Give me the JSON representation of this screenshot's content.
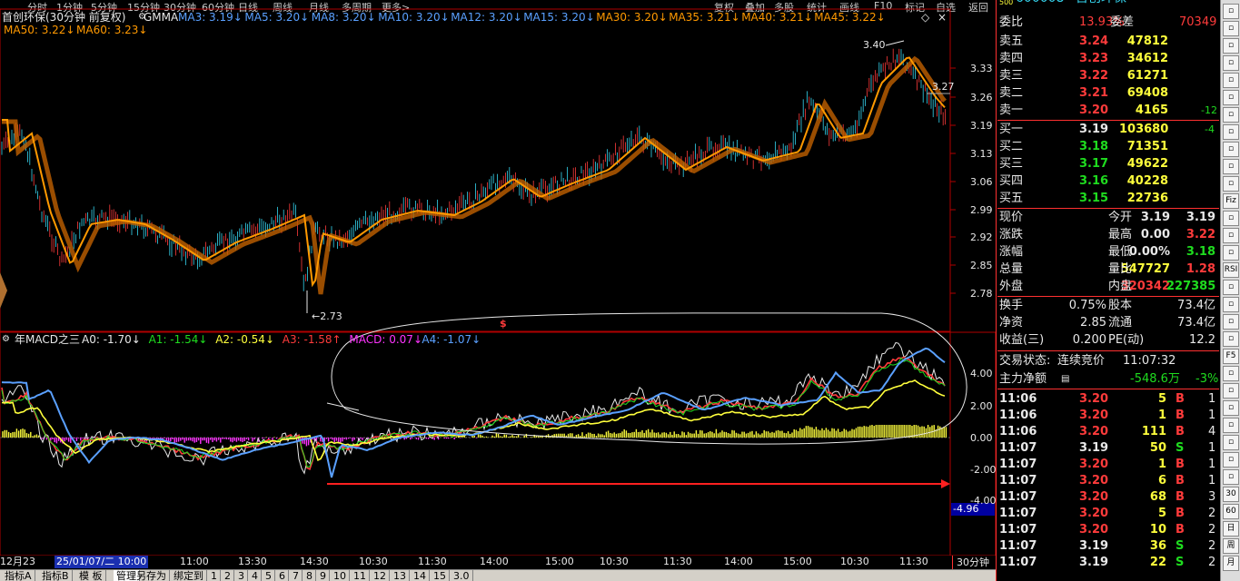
{
  "top_menu": [
    "分时",
    "1分钟",
    "5分钟",
    "15分钟",
    "30分钟",
    "60分钟",
    "日线",
    "周线",
    "月线",
    "多周期",
    "更多>",
    "复权",
    "叠加",
    "多股",
    "统计",
    "画线",
    "F10",
    "标记",
    "自选",
    "返回"
  ],
  "stock_code": "600008",
  "stock_name": "首创环保",
  "stock_code_small": "500",
  "main_header": {
    "title": "首创环保(30分钟 前复权)",
    "indicator": "GMMA",
    "mas": [
      {
        "label": "MA3: 3.19",
        "arrow": "↓",
        "color": "#5aa0ff"
      },
      {
        "label": "MA5: 3.20",
        "arrow": "↓",
        "color": "#5aa0ff"
      },
      {
        "label": "MA8: 3.20",
        "arrow": "↓",
        "color": "#5aa0ff"
      },
      {
        "label": "MA10: 3.20",
        "arrow": "↓",
        "color": "#5aa0ff"
      },
      {
        "label": "MA12: 3.20",
        "arrow": "↓",
        "color": "#5aa0ff"
      },
      {
        "label": "MA15: 3.20",
        "arrow": "↓",
        "color": "#5aa0ff"
      },
      {
        "label": "MA30: 3.20",
        "arrow": "↓",
        "color": "#ff9900"
      },
      {
        "label": "MA35: 3.21",
        "arrow": "↓",
        "color": "#ff9900"
      },
      {
        "label": "MA40: 3.21",
        "arrow": "↓",
        "color": "#ff9900"
      },
      {
        "label": "MA45: 3.22",
        "arrow": "↓",
        "color": "#ff9900"
      },
      {
        "label": "MA50: 3.22",
        "arrow": "↓",
        "color": "#ff9900"
      },
      {
        "label": "MA60: 3.23",
        "arrow": "↓",
        "color": "#ff9900"
      }
    ],
    "high_mark": "3.40",
    "low_mark": "2.73",
    "price_tag": "3.27"
  },
  "price_axis": [
    "3.33",
    "3.26",
    "3.19",
    "3.13",
    "3.06",
    "2.99",
    "2.92",
    "2.85",
    "2.78"
  ],
  "macd_header": {
    "title": "年MACD之三",
    "items": [
      {
        "label": "A0: -1.70",
        "arrow": "↓",
        "color": "#e8e8e8"
      },
      {
        "label": "A1: -1.54",
        "arrow": "↓",
        "color": "#1fdc1f"
      },
      {
        "label": "A2: -0.54",
        "arrow": "↓",
        "color": "#ffff3c"
      },
      {
        "label": "A3: -1.58",
        "arrow": "↑",
        "color": "#ff3b3b"
      },
      {
        "label": "MACD: 0.07",
        "arrow": "↓",
        "color": "#ff33ff"
      },
      {
        "label": "A4: -1.07",
        "arrow": "↓",
        "color": "#5aa0ff"
      }
    ],
    "marker": "$",
    "value_tag": "-4.96"
  },
  "macd_axis": [
    "4.00",
    "2.00",
    "0.00",
    "-2.00",
    "-4.00"
  ],
  "time_axis": [
    "12月23",
    "25/01/07/二 10:00",
    "11:00",
    "13:30",
    "14:30",
    "10:30",
    "11:30",
    "14:00",
    "15:00",
    "10:30",
    "11:30",
    "14:00",
    "15:00",
    "10:30",
    "11:30"
  ],
  "period_label": "30分钟",
  "bottom_tabs": [
    "指标A",
    "指标B",
    "模 板",
    "管理",
    "另存为",
    "绑定到",
    "1",
    "2",
    "3",
    "4",
    "5",
    "6",
    "7",
    "8",
    "9",
    "10",
    "11",
    "12",
    "13",
    "14",
    "15",
    "3.0"
  ],
  "order_book": {
    "weibi_label": "委比",
    "weibi_value": "13.93%",
    "weicha_label": "委差",
    "weicha_value": "70349",
    "sells": [
      {
        "label": "卖五",
        "price": "3.24",
        "vol": "47812",
        "chg": ""
      },
      {
        "label": "卖四",
        "price": "3.23",
        "vol": "34612",
        "chg": ""
      },
      {
        "label": "卖三",
        "price": "3.22",
        "vol": "61271",
        "chg": ""
      },
      {
        "label": "卖二",
        "price": "3.21",
        "vol": "69408",
        "chg": ""
      },
      {
        "label": "卖一",
        "price": "3.20",
        "vol": "4165",
        "chg": "-12"
      }
    ],
    "buys": [
      {
        "label": "买一",
        "price": "3.19",
        "vol": "103680",
        "chg": "-4"
      },
      {
        "label": "买二",
        "price": "3.18",
        "vol": "71351",
        "chg": ""
      },
      {
        "label": "买三",
        "price": "3.17",
        "vol": "49622",
        "chg": ""
      },
      {
        "label": "买四",
        "price": "3.16",
        "vol": "40228",
        "chg": ""
      },
      {
        "label": "买五",
        "price": "3.15",
        "vol": "22736",
        "chg": ""
      }
    ]
  },
  "quote": [
    {
      "l1": "现价",
      "v1": "3.19",
      "c1": "#e8e8e8",
      "l2": "今开",
      "v2": "3.19",
      "c2": "#e8e8e8"
    },
    {
      "l1": "涨跌",
      "v1": "0.00",
      "c1": "#e8e8e8",
      "l2": "最高",
      "v2": "3.22",
      "c2": "#ff3b3b"
    },
    {
      "l1": "涨幅",
      "v1": "0.00%",
      "c1": "#e8e8e8",
      "l2": "最低",
      "v2": "3.18",
      "c2": "#1fdc1f"
    },
    {
      "l1": "总量",
      "v1": "547727",
      "c1": "#ffff3c",
      "l2": "量比",
      "v2": "1.28",
      "c2": "#ff3b3b"
    },
    {
      "l1": "外盘",
      "v1": "320342",
      "c1": "#ff3b3b",
      "l2": "内盘",
      "v2": "227385",
      "c2": "#1fdc1f"
    }
  ],
  "quote2": [
    {
      "l1": "换手",
      "v1": "0.75%",
      "l2": "股本",
      "v2": "73.4亿"
    },
    {
      "l1": "净资",
      "v1": "2.85",
      "l2": "流通",
      "v2": "73.4亿"
    },
    {
      "l1": "收益(三)",
      "v1": "0.200",
      "l2": "PE(动)",
      "v2": "12.2"
    }
  ],
  "status": {
    "label": "交易状态:",
    "value": "连续竞价",
    "time": "11:07:32"
  },
  "netflow": {
    "label": "主力净额",
    "value": "-548.6万",
    "pct": "-3%"
  },
  "ticks": [
    {
      "time": "11:06",
      "price": "3.20",
      "vol": "5",
      "bs": "B",
      "n": "1",
      "pc": "#ff3b3b"
    },
    {
      "time": "11:06",
      "price": "3.20",
      "vol": "1",
      "bs": "B",
      "n": "1",
      "pc": "#ff3b3b"
    },
    {
      "time": "11:06",
      "price": "3.20",
      "vol": "111",
      "bs": "B",
      "n": "4",
      "pc": "#ff3b3b"
    },
    {
      "time": "11:07",
      "price": "3.19",
      "vol": "50",
      "bs": "S",
      "n": "1",
      "pc": "#e8e8e8"
    },
    {
      "time": "11:07",
      "price": "3.20",
      "vol": "1",
      "bs": "B",
      "n": "1",
      "pc": "#ff3b3b"
    },
    {
      "time": "11:07",
      "price": "3.20",
      "vol": "6",
      "bs": "B",
      "n": "1",
      "pc": "#ff3b3b"
    },
    {
      "time": "11:07",
      "price": "3.20",
      "vol": "68",
      "bs": "B",
      "n": "3",
      "pc": "#ff3b3b"
    },
    {
      "time": "11:07",
      "price": "3.20",
      "vol": "5",
      "bs": "B",
      "n": "2",
      "pc": "#ff3b3b"
    },
    {
      "time": "11:07",
      "price": "3.20",
      "vol": "10",
      "bs": "B",
      "n": "2",
      "pc": "#ff3b3b"
    },
    {
      "time": "11:07",
      "price": "3.19",
      "vol": "36",
      "bs": "S",
      "n": "2",
      "pc": "#e8e8e8"
    },
    {
      "time": "11:07",
      "price": "3.19",
      "vol": "22",
      "bs": "S",
      "n": "2",
      "pc": "#e8e8e8"
    }
  ],
  "right_tools": [
    "",
    "",
    "",
    "",
    "",
    "",
    "",
    "",
    "",
    "",
    "",
    "Fiz",
    "",
    "",
    "",
    "RSI",
    "",
    "",
    "",
    "",
    "F5",
    "",
    "",
    "",
    "",
    "",
    "",
    "",
    "30",
    "60",
    "日",
    "周",
    "月"
  ],
  "colors": {
    "up": "#ff3b3b",
    "down": "#1fdc1f",
    "ma_fast": "#5aa0ff",
    "ma_slow": "#ff9900",
    "macd_hist_pos": "#ffff3c",
    "macd_hist_neg": "#ff33ff"
  }
}
